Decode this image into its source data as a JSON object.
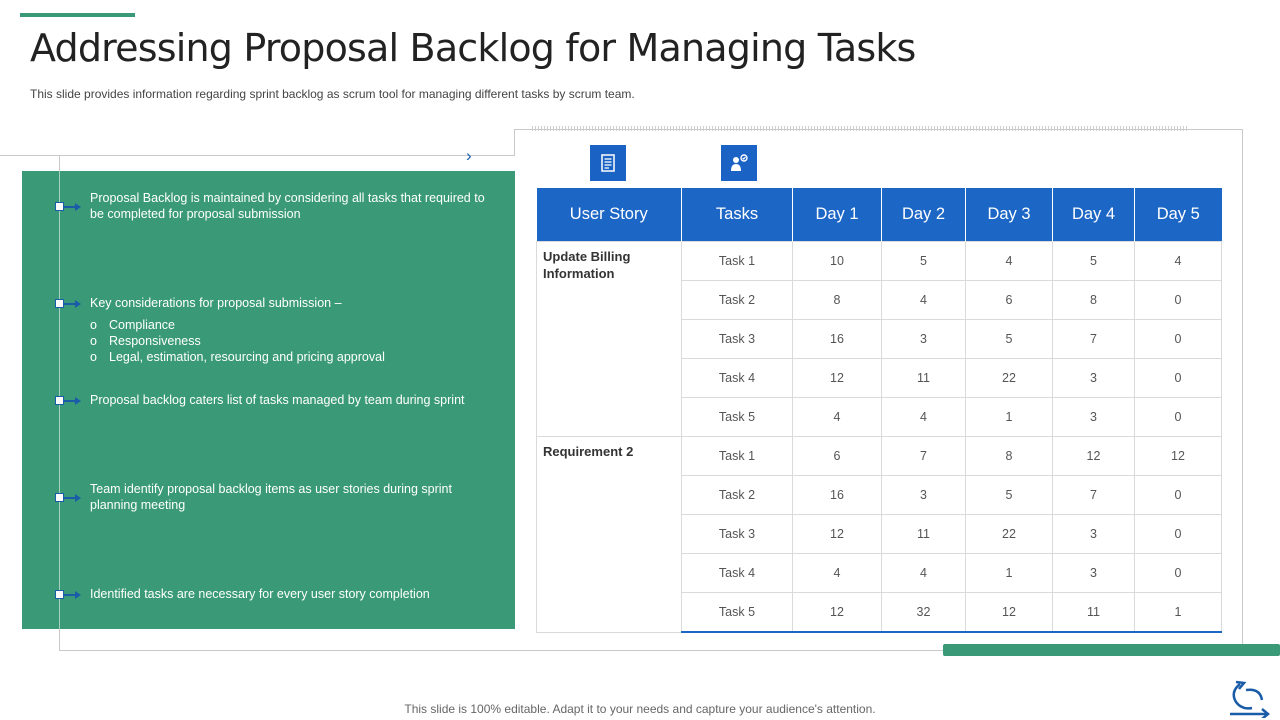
{
  "slide": {
    "title": "Addressing Proposal Backlog for Managing Tasks",
    "subtitle": "This slide provides information regarding sprint backlog as scrum tool for managing different tasks by scrum team.",
    "footer": "This slide is 100% editable. Adapt it to your needs and capture your audience's attention."
  },
  "panel": {
    "points": [
      "Proposal Backlog is maintained by considering all tasks that required to be completed for proposal submission",
      "Key considerations for proposal submission –",
      "Proposal backlog caters list of tasks managed by team during sprint",
      "Team identify proposal backlog items as user stories during sprint planning meeting",
      "Identified tasks are necessary for every user story completion"
    ],
    "sub_marker": "o",
    "sub_points": [
      "Compliance",
      "Responsiveness",
      "Legal, estimation, resourcing and pricing approval"
    ]
  },
  "icons": [
    "document-icon",
    "team-person-icon"
  ],
  "table": {
    "headers": [
      "User Story",
      "Tasks",
      "Day 1",
      "Day 2",
      "Day 3",
      "Day 4",
      "Day 5"
    ],
    "stories": [
      {
        "name": "Update Billing Information",
        "rows": [
          [
            "Task 1",
            "10",
            "5",
            "4",
            "5",
            "4"
          ],
          [
            "Task 2",
            "8",
            "4",
            "6",
            "8",
            "0"
          ],
          [
            "Task 3",
            "16",
            "3",
            "5",
            "7",
            "0"
          ],
          [
            "Task 4",
            "12",
            "11",
            "22",
            "3",
            "0"
          ],
          [
            "Task 5",
            "4",
            "4",
            "1",
            "3",
            "0"
          ]
        ]
      },
      {
        "name": "Requirement 2",
        "rows": [
          [
            "Task 1",
            "6",
            "7",
            "8",
            "12",
            "12"
          ],
          [
            "Task 2",
            "16",
            "3",
            "5",
            "7",
            "0"
          ],
          [
            "Task 3",
            "12",
            "11",
            "22",
            "3",
            "0"
          ],
          [
            "Task 4",
            "4",
            "4",
            "1",
            "3",
            "0"
          ],
          [
            "Task 5",
            "12",
            "32",
            "12",
            "11",
            "1"
          ]
        ]
      }
    ]
  },
  "colors": {
    "green": "#3a9a78",
    "blue": "#1c66c6",
    "accent_navy": "#1a5ca8"
  }
}
